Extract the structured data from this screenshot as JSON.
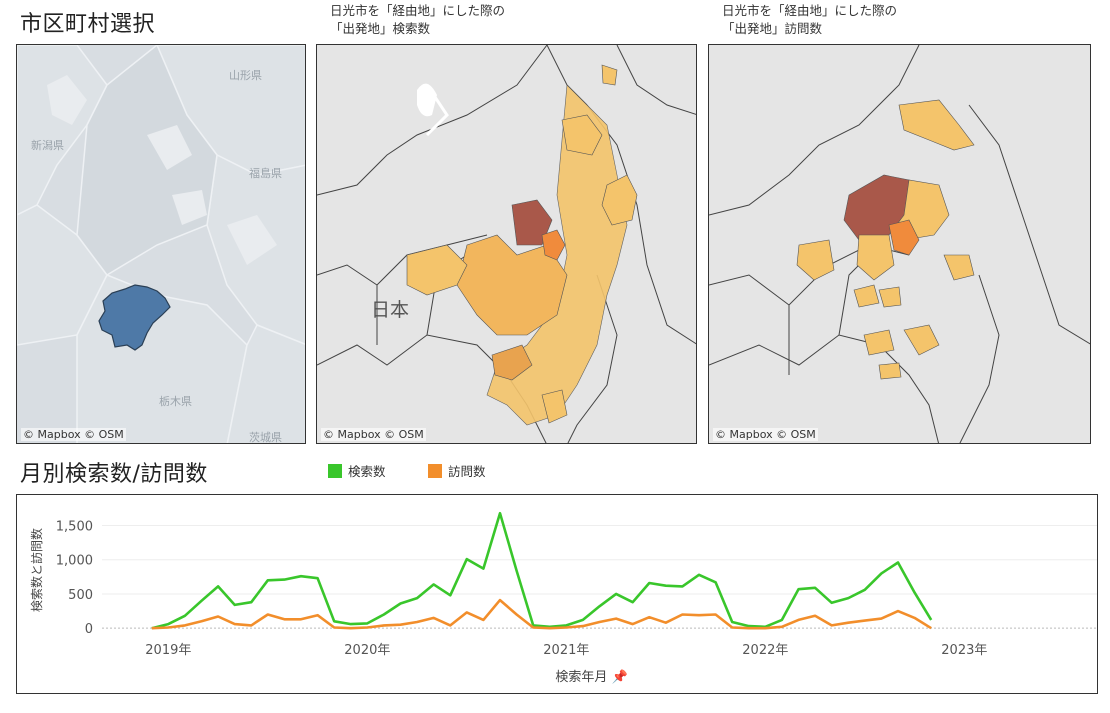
{
  "titles": {
    "select": "市区町村選択",
    "monthly": "月別検索数/訪問数"
  },
  "captions": {
    "search": [
      "日光市を「経由地」にした際の",
      "「出発地」検索数"
    ],
    "visit": [
      "日光市を「経由地」にした際の",
      "「出発地」訪問数"
    ]
  },
  "maps": {
    "attribution": "© Mapbox © OSM",
    "select_labels": {
      "yamagata": "山形県",
      "niigata": "新潟県",
      "fukushima": "福島県",
      "tochigi": "栃木県",
      "ibaraki": "茨城県"
    },
    "country_label": "日本"
  },
  "legend": {
    "search": "検索数",
    "visit": "訪問数"
  },
  "colors": {
    "search": "#39c62b",
    "visit": "#f28e2b",
    "selected_region": "#4e79a7",
    "heat_low": "#f4c46b",
    "heat_mid": "#e8a34f",
    "heat_high": "#a9584a",
    "heat_orange": "#f08b3c"
  },
  "chart_data": {
    "type": "line",
    "xlabel": "検索年月",
    "ylabel": "検索数と訪問数",
    "xlim": [
      "2018-09",
      "2023-09"
    ],
    "ylim": [
      -100,
      1800
    ],
    "yticks": [
      0,
      500,
      1000,
      1500
    ],
    "ytick_labels": [
      "0",
      "500",
      "1,000",
      "1,500"
    ],
    "xticks": [
      "2019-01",
      "2020-01",
      "2021-01",
      "2022-01",
      "2023-01"
    ],
    "xtick_labels": [
      "2019年",
      "2020年",
      "2021年",
      "2022年",
      "2023年"
    ],
    "x": [
      "2018-12",
      "2019-01",
      "2019-02",
      "2019-03",
      "2019-04",
      "2019-05",
      "2019-06",
      "2019-07",
      "2019-08",
      "2019-09",
      "2019-10",
      "2019-11",
      "2019-12",
      "2020-01",
      "2020-02",
      "2020-03",
      "2020-04",
      "2020-05",
      "2020-06",
      "2020-07",
      "2020-08",
      "2020-09",
      "2020-10",
      "2020-11",
      "2020-12",
      "2021-01",
      "2021-02",
      "2021-03",
      "2021-04",
      "2021-05",
      "2021-06",
      "2021-07",
      "2021-08",
      "2021-09",
      "2021-10",
      "2021-11",
      "2021-12",
      "2022-01",
      "2022-02",
      "2022-03",
      "2022-04",
      "2022-05",
      "2022-06",
      "2022-07",
      "2022-08",
      "2022-09",
      "2022-10",
      "2022-11",
      "2022-12"
    ],
    "series": [
      {
        "name": "検索数",
        "values": [
          0,
          60,
          180,
          400,
          610,
          340,
          380,
          700,
          710,
          760,
          730,
          100,
          60,
          70,
          200,
          360,
          440,
          640,
          480,
          1010,
          870,
          1680,
          840,
          40,
          20,
          40,
          120,
          320,
          500,
          380,
          660,
          620,
          610,
          780,
          670,
          90,
          30,
          20,
          120,
          570,
          590,
          370,
          440,
          560,
          800,
          960,
          520,
          120
        ]
      },
      {
        "name": "訪問数",
        "values": [
          0,
          10,
          40,
          100,
          170,
          60,
          40,
          200,
          130,
          130,
          190,
          10,
          0,
          10,
          40,
          50,
          90,
          150,
          40,
          230,
          120,
          410,
          200,
          10,
          0,
          10,
          30,
          90,
          140,
          60,
          160,
          80,
          200,
          190,
          200,
          10,
          0,
          0,
          20,
          120,
          180,
          40,
          80,
          110,
          140,
          250,
          150,
          0
        ]
      }
    ]
  }
}
